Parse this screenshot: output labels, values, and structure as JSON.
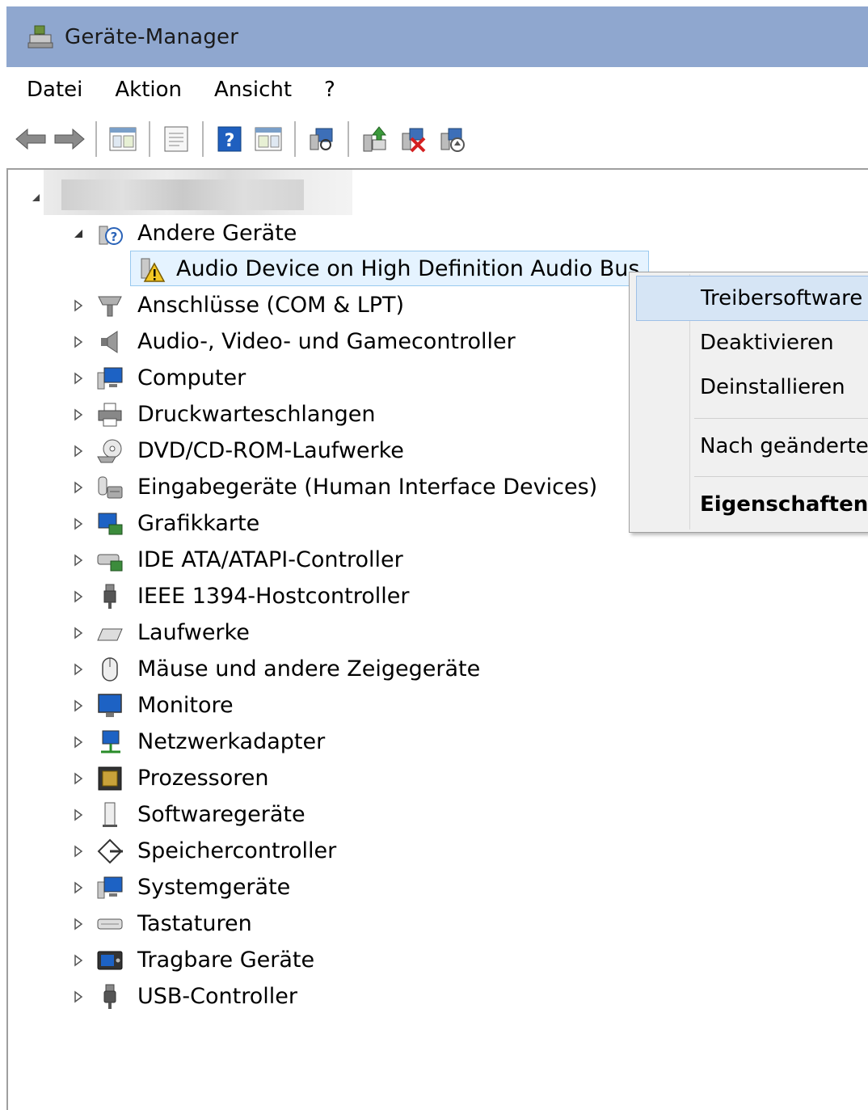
{
  "window": {
    "title": "Geräte-Manager"
  },
  "menu": {
    "items": [
      "Datei",
      "Aktion",
      "Ansicht",
      "?"
    ]
  },
  "tree": {
    "category_open": "Andere Geräte",
    "selected_device": "Audio Device on High Definition Audio Bus",
    "categories": [
      "Anschlüsse (COM & LPT)",
      "Audio-, Video- und Gamecontroller",
      "Computer",
      "Druckwarteschlangen",
      "DVD/CD-ROM-Laufwerke",
      "Eingabegeräte (Human Interface Devices)",
      "Grafikkarte",
      "IDE ATA/ATAPI-Controller",
      "IEEE 1394-Hostcontroller",
      "Laufwerke",
      "Mäuse und andere Zeigegeräte",
      "Monitore",
      "Netzwerkadapter",
      "Prozessoren",
      "Softwaregeräte",
      "Speichercontroller",
      "Systemgeräte",
      "Tastaturen",
      "Tragbare Geräte",
      "USB-Controller"
    ]
  },
  "context_menu": {
    "items": [
      "Treibersoftware",
      "Deaktivieren",
      "Deinstallieren",
      "Nach geänderte",
      "Eigenschaften"
    ]
  },
  "colors": {
    "title_bar": "#8fa7cf",
    "selection": "#e5f3ff",
    "menu_hover": "#d6e5f5"
  }
}
